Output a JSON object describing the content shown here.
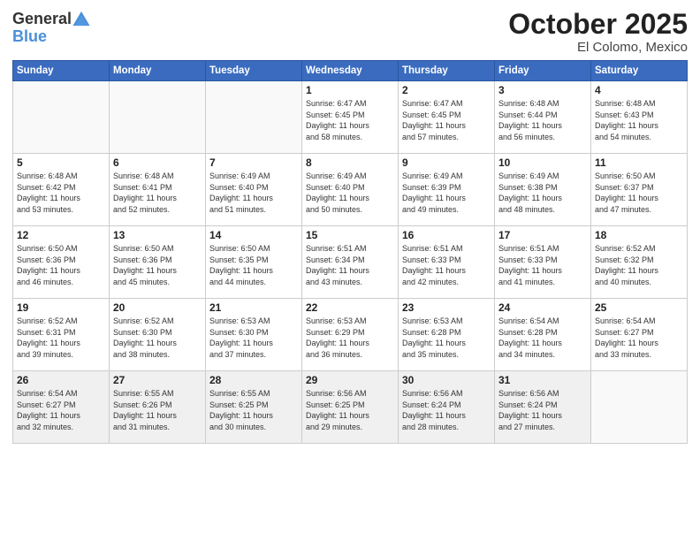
{
  "header": {
    "logo_general": "General",
    "logo_blue": "Blue",
    "month": "October 2025",
    "location": "El Colomo, Mexico"
  },
  "days_of_week": [
    "Sunday",
    "Monday",
    "Tuesday",
    "Wednesday",
    "Thursday",
    "Friday",
    "Saturday"
  ],
  "weeks": [
    [
      {
        "day": "",
        "info": ""
      },
      {
        "day": "",
        "info": ""
      },
      {
        "day": "",
        "info": ""
      },
      {
        "day": "1",
        "info": "Sunrise: 6:47 AM\nSunset: 6:45 PM\nDaylight: 11 hours\nand 58 minutes."
      },
      {
        "day": "2",
        "info": "Sunrise: 6:47 AM\nSunset: 6:45 PM\nDaylight: 11 hours\nand 57 minutes."
      },
      {
        "day": "3",
        "info": "Sunrise: 6:48 AM\nSunset: 6:44 PM\nDaylight: 11 hours\nand 56 minutes."
      },
      {
        "day": "4",
        "info": "Sunrise: 6:48 AM\nSunset: 6:43 PM\nDaylight: 11 hours\nand 54 minutes."
      }
    ],
    [
      {
        "day": "5",
        "info": "Sunrise: 6:48 AM\nSunset: 6:42 PM\nDaylight: 11 hours\nand 53 minutes."
      },
      {
        "day": "6",
        "info": "Sunrise: 6:48 AM\nSunset: 6:41 PM\nDaylight: 11 hours\nand 52 minutes."
      },
      {
        "day": "7",
        "info": "Sunrise: 6:49 AM\nSunset: 6:40 PM\nDaylight: 11 hours\nand 51 minutes."
      },
      {
        "day": "8",
        "info": "Sunrise: 6:49 AM\nSunset: 6:40 PM\nDaylight: 11 hours\nand 50 minutes."
      },
      {
        "day": "9",
        "info": "Sunrise: 6:49 AM\nSunset: 6:39 PM\nDaylight: 11 hours\nand 49 minutes."
      },
      {
        "day": "10",
        "info": "Sunrise: 6:49 AM\nSunset: 6:38 PM\nDaylight: 11 hours\nand 48 minutes."
      },
      {
        "day": "11",
        "info": "Sunrise: 6:50 AM\nSunset: 6:37 PM\nDaylight: 11 hours\nand 47 minutes."
      }
    ],
    [
      {
        "day": "12",
        "info": "Sunrise: 6:50 AM\nSunset: 6:36 PM\nDaylight: 11 hours\nand 46 minutes."
      },
      {
        "day": "13",
        "info": "Sunrise: 6:50 AM\nSunset: 6:36 PM\nDaylight: 11 hours\nand 45 minutes."
      },
      {
        "day": "14",
        "info": "Sunrise: 6:50 AM\nSunset: 6:35 PM\nDaylight: 11 hours\nand 44 minutes."
      },
      {
        "day": "15",
        "info": "Sunrise: 6:51 AM\nSunset: 6:34 PM\nDaylight: 11 hours\nand 43 minutes."
      },
      {
        "day": "16",
        "info": "Sunrise: 6:51 AM\nSunset: 6:33 PM\nDaylight: 11 hours\nand 42 minutes."
      },
      {
        "day": "17",
        "info": "Sunrise: 6:51 AM\nSunset: 6:33 PM\nDaylight: 11 hours\nand 41 minutes."
      },
      {
        "day": "18",
        "info": "Sunrise: 6:52 AM\nSunset: 6:32 PM\nDaylight: 11 hours\nand 40 minutes."
      }
    ],
    [
      {
        "day": "19",
        "info": "Sunrise: 6:52 AM\nSunset: 6:31 PM\nDaylight: 11 hours\nand 39 minutes."
      },
      {
        "day": "20",
        "info": "Sunrise: 6:52 AM\nSunset: 6:30 PM\nDaylight: 11 hours\nand 38 minutes."
      },
      {
        "day": "21",
        "info": "Sunrise: 6:53 AM\nSunset: 6:30 PM\nDaylight: 11 hours\nand 37 minutes."
      },
      {
        "day": "22",
        "info": "Sunrise: 6:53 AM\nSunset: 6:29 PM\nDaylight: 11 hours\nand 36 minutes."
      },
      {
        "day": "23",
        "info": "Sunrise: 6:53 AM\nSunset: 6:28 PM\nDaylight: 11 hours\nand 35 minutes."
      },
      {
        "day": "24",
        "info": "Sunrise: 6:54 AM\nSunset: 6:28 PM\nDaylight: 11 hours\nand 34 minutes."
      },
      {
        "day": "25",
        "info": "Sunrise: 6:54 AM\nSunset: 6:27 PM\nDaylight: 11 hours\nand 33 minutes."
      }
    ],
    [
      {
        "day": "26",
        "info": "Sunrise: 6:54 AM\nSunset: 6:27 PM\nDaylight: 11 hours\nand 32 minutes."
      },
      {
        "day": "27",
        "info": "Sunrise: 6:55 AM\nSunset: 6:26 PM\nDaylight: 11 hours\nand 31 minutes."
      },
      {
        "day": "28",
        "info": "Sunrise: 6:55 AM\nSunset: 6:25 PM\nDaylight: 11 hours\nand 30 minutes."
      },
      {
        "day": "29",
        "info": "Sunrise: 6:56 AM\nSunset: 6:25 PM\nDaylight: 11 hours\nand 29 minutes."
      },
      {
        "day": "30",
        "info": "Sunrise: 6:56 AM\nSunset: 6:24 PM\nDaylight: 11 hours\nand 28 minutes."
      },
      {
        "day": "31",
        "info": "Sunrise: 6:56 AM\nSunset: 6:24 PM\nDaylight: 11 hours\nand 27 minutes."
      },
      {
        "day": "",
        "info": ""
      }
    ]
  ]
}
